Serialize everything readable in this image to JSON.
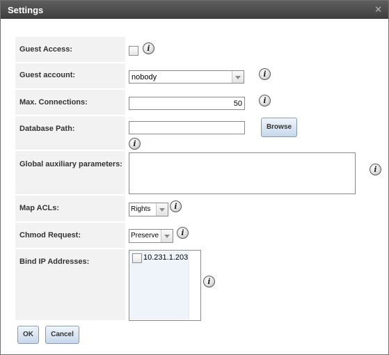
{
  "window": {
    "title": "Settings",
    "close_glyph": "✕"
  },
  "form": {
    "guest_access": {
      "label": "Guest Access:",
      "checked": false
    },
    "guest_account": {
      "label": "Guest account:",
      "value": "nobody"
    },
    "max_connections": {
      "label": "Max. Connections:",
      "value": "50"
    },
    "database_path": {
      "label": "Database Path:",
      "value": "",
      "browse_label": "Browse"
    },
    "global_aux": {
      "label": "Global auxiliary parameters:",
      "value": ""
    },
    "map_acls": {
      "label": "Map ACLs:",
      "value": "Rights"
    },
    "chmod_request": {
      "label": "Chmod Request:",
      "value": "Preserve"
    },
    "bind_ip": {
      "label": "Bind IP Addresses:",
      "options": [
        {
          "label": "10.231.1.203",
          "checked": false
        }
      ]
    }
  },
  "info_glyph": "i",
  "buttons": {
    "ok": "OK",
    "cancel": "Cancel"
  },
  "colors": {
    "titlebar": "#4a4a4a",
    "label_bg": "#f2f2f2",
    "button_border": "#7d9ab8"
  }
}
